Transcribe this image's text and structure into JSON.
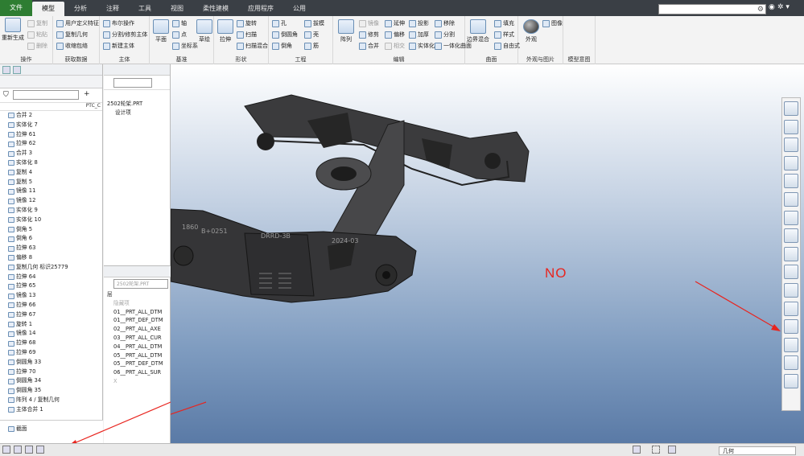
{
  "tabs": [
    {
      "label": "文件"
    },
    {
      "label": "模型"
    },
    {
      "label": "分析"
    },
    {
      "label": "注释"
    },
    {
      "label": "工具"
    },
    {
      "label": "视图"
    },
    {
      "label": "柔性建模"
    },
    {
      "label": "应用程序"
    },
    {
      "label": "公用"
    }
  ],
  "ribbon": {
    "operations": {
      "regen": "重新生成",
      "copy": "复制",
      "paste": "粘贴",
      "delete": "删除",
      "label": "操作"
    },
    "get_data": {
      "udf": "用户定义特征",
      "copy_geom": "复制几何",
      "shrinkwrap": "收缩包络",
      "label": "获取数据"
    },
    "body": {
      "boolean": "布尔操作",
      "split_trim": "分割/修剪主体",
      "new_body": "新建主体",
      "label": "主体"
    },
    "datum": {
      "plane": "平面",
      "axis": "轴",
      "point": "点",
      "csys": "坐标系",
      "sketch": "草绘",
      "label": "基准"
    },
    "shapes": {
      "extrude": "拉伸",
      "revolve": "旋转",
      "sweep": "扫描",
      "sweep_blend": "扫描混合",
      "label": "形状"
    },
    "engineering": {
      "hole": "孔",
      "round": "倒圆角",
      "chamfer": "倒角",
      "draft": "拔模",
      "shell": "壳",
      "rib": "筋",
      "label": "工程"
    },
    "editing": {
      "pattern": "阵列",
      "mirror": "镜像",
      "trim": "修剪",
      "merge": "合并",
      "extend": "延伸",
      "offset": "偏移",
      "intersect": "相交",
      "project": "投影",
      "thicken": "加厚",
      "solidify": "实体化",
      "remove": "移除",
      "split": "分割",
      "unify": "一体化曲面",
      "label": "编辑"
    },
    "surfaces": {
      "boundary_blend": "边界混合",
      "fill": "填充",
      "style": "样式",
      "freestyle": "自由式",
      "label": "曲面"
    },
    "appearance": {
      "appearance": "外观",
      "decal": "图像",
      "label": "外观与图片"
    },
    "model_intent": {
      "label": "模型意图"
    }
  },
  "left_panel": {
    "column_header": "PTC_C",
    "tree": [
      {
        "label": "合并 2"
      },
      {
        "label": "实体化 7"
      },
      {
        "label": "拉伸 61"
      },
      {
        "label": "拉伸 62"
      },
      {
        "label": "合并 3"
      },
      {
        "label": "实体化 8"
      },
      {
        "label": "复制 4"
      },
      {
        "label": "复制 5"
      },
      {
        "label": "镜像 11"
      },
      {
        "label": "镜像 12"
      },
      {
        "label": "实体化 9"
      },
      {
        "label": "实体化 10"
      },
      {
        "label": "倒角 5"
      },
      {
        "label": "倒角 6"
      },
      {
        "label": "拉伸 63"
      },
      {
        "label": "偏移 8"
      },
      {
        "label": "复制几何 标识25779"
      },
      {
        "label": "拉伸 64"
      },
      {
        "label": "拉伸 65"
      },
      {
        "label": "镜像 13"
      },
      {
        "label": "拉伸 66"
      },
      {
        "label": "拉伸 67"
      },
      {
        "label": "旋转 1"
      },
      {
        "label": "镜像 14"
      },
      {
        "label": "拉伸 68"
      },
      {
        "label": "拉伸 69"
      },
      {
        "label": "倒圆角 33"
      },
      {
        "label": "拉伸 70"
      },
      {
        "label": "倒圆角 34"
      },
      {
        "label": "倒圆角 35"
      },
      {
        "label": "阵列 4 / 复制几何"
      },
      {
        "label": "主体合并 1"
      }
    ],
    "section_label": "截面"
  },
  "mid_panel": {
    "part_name": "2502轮架.PRT",
    "design_item": "设计项",
    "layer_model": "2502轮架.PRT",
    "layer_root": "层",
    "layers": [
      {
        "label": "隐藏项"
      },
      {
        "label": "01__PRT_ALL_DTM"
      },
      {
        "label": "01__PRT_DEF_DTM"
      },
      {
        "label": "02__PRT_ALL_AXE"
      },
      {
        "label": "03__PRT_ALL_CUR"
      },
      {
        "label": "04__PRT_ALL_DTM"
      },
      {
        "label": "05__PRT_ALL_DTM"
      },
      {
        "label": "05__PRT_DEF_DTM"
      },
      {
        "label": "06__PRT_ALL_SUR"
      },
      {
        "label": "X"
      }
    ]
  },
  "viewport": {
    "overlay_text": "NO",
    "part_markings": [
      "1860",
      "B+0251",
      "DRRD-3B",
      "2024-03"
    ]
  },
  "status": {
    "selection_filter": "几何"
  },
  "colors": {
    "accent": "#2e7d32",
    "annotation": "#e8241e",
    "tabbar": "#3a3f45"
  }
}
